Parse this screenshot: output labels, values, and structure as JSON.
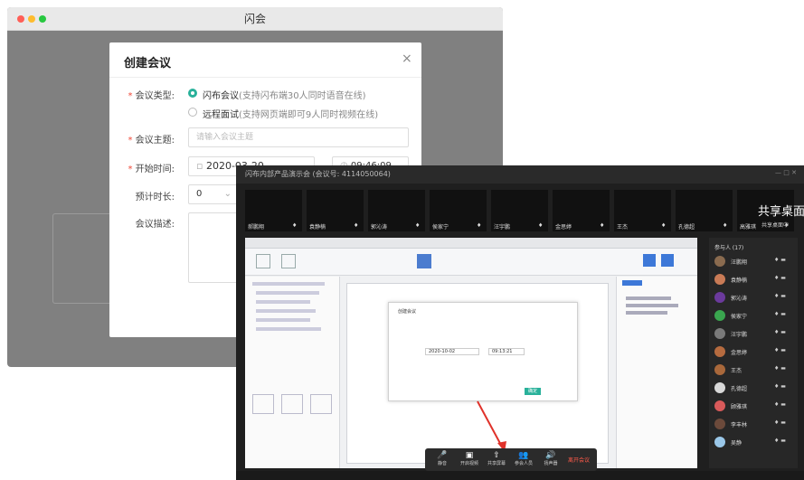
{
  "app": {
    "title": "闪会"
  },
  "dialog": {
    "title": "创建会议",
    "close_glyph": "×",
    "meeting_type": {
      "label": "会议类型:",
      "options": [
        {
          "name": "闪布会议",
          "note": "(支持闪布端30人同时语音在线)",
          "selected": true
        },
        {
          "name": "远程面试",
          "note": "(支持网页端即可9人同时视频在线)",
          "selected": false
        }
      ]
    },
    "topic": {
      "label": "会议主题:",
      "placeholder": "请输入会议主题"
    },
    "start_time": {
      "label": "开始时间:",
      "date": "2020-03-20",
      "time": "09:46:09"
    },
    "duration": {
      "label": "预计时长:",
      "value": "0"
    },
    "description": {
      "label": "会议描述:"
    }
  },
  "meeting": {
    "window_title": "闪布内部产品演示会 (会议号: 4114050064)",
    "tiles": [
      {
        "name": "郝鹏翔"
      },
      {
        "name": "袁静楠"
      },
      {
        "name": "郭沁涛"
      },
      {
        "name": "侯家宁"
      },
      {
        "name": "汪宇鹏"
      },
      {
        "name": "金思婷"
      },
      {
        "name": "王杰"
      },
      {
        "name": "孔德超"
      },
      {
        "name": "高雅琪"
      }
    ],
    "share_label": "共享桌面",
    "share_sub": "共享桌面中",
    "participants_title": "参与人 (17)",
    "participants": [
      {
        "name": "汪鹏翔",
        "color": "#8a6b4f"
      },
      {
        "name": "袁静楠",
        "color": "#c97b56"
      },
      {
        "name": "郭沁涛",
        "color": "#6b3a9c"
      },
      {
        "name": "侯家宁",
        "color": "#3aa64f"
      },
      {
        "name": "汪宇鹏",
        "color": "#7a7a7a"
      },
      {
        "name": "金思婷",
        "color": "#b66b3f"
      },
      {
        "name": "王杰",
        "color": "#a9683b"
      },
      {
        "name": "孔德超",
        "color": "#d8d8d8"
      },
      {
        "name": "顾雅琪",
        "color": "#d95a5a"
      },
      {
        "name": "李丰林",
        "color": "#6c4a3b"
      },
      {
        "name": "吴静",
        "color": "#9ac7e8"
      }
    ],
    "controls": [
      {
        "icon": "🎤",
        "label": "静音"
      },
      {
        "icon": "▣",
        "label": "开启视频"
      },
      {
        "icon": "⇧",
        "label": "共享屏幕"
      },
      {
        "icon": "👥",
        "label": "参会人员"
      },
      {
        "icon": "🔊",
        "label": "扬声器"
      }
    ],
    "leave_label": "离开会议"
  },
  "inner_dialog": {
    "title": "创建会议",
    "date": "2020-10-02",
    "time": "09:13:21",
    "button": "确定"
  }
}
